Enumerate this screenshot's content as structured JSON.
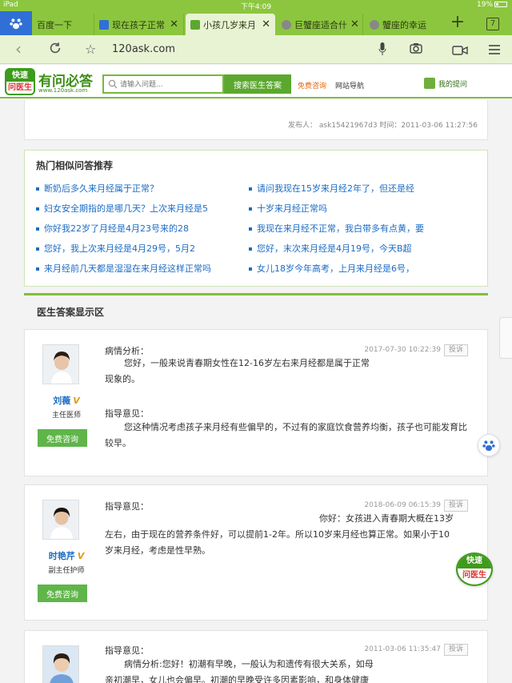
{
  "status_bar": {
    "device": "iPad",
    "time": "下午4:09",
    "battery": "19%"
  },
  "tabs": [
    {
      "label": "百度一下",
      "favicon_color": "#2f6fd6"
    },
    {
      "label": "现在孩子正常",
      "favicon_color": "#2f6fd6"
    },
    {
      "label": "小孩几岁来月",
      "favicon_color": "#5ba82e"
    },
    {
      "label": "巨蟹座适合什",
      "favicon_color": "#888888"
    },
    {
      "label": "蟹座的幸运",
      "favicon_color": "#888888"
    }
  ],
  "tab_count": "7",
  "address": {
    "url": "120ask.com"
  },
  "site": {
    "logo_top": "快速",
    "logo_bottom": "问医生",
    "name": "有问必答",
    "domain": "www.120ask.com",
    "search_placeholder": "请输入问题...",
    "search_button": "搜索医生答案",
    "free_consult": "免费咨询",
    "site_nav": "网站导航",
    "my_questions": "我的提问"
  },
  "question_meta": {
    "author_line": "发布人： ask15421967d3 时间：2011-03-06 11:27:56"
  },
  "hot": {
    "title": "热门相似问答推荐",
    "left": [
      "断奶后多久来月经属于正常？",
      "妇女安全期指的是哪几天？上次来月经是5",
      "你好我22岁了月经是4月23号来的28",
      "您好，我上次来月经是4月29号，5月2",
      "来月经前几天都是湿湿在来月经这样正常吗"
    ],
    "right": [
      "请问我现在15岁来月经2年了，但还是经",
      "十岁来月经正常吗",
      "我现在来月经不正常，我白带多有点黄，要",
      "您好，末次来月经是4月19号，今天B超",
      "女儿18岁今年高考，上月来月经是6号，"
    ]
  },
  "answers_section_title": "医生答案显示区",
  "answers": [
    {
      "doctor": "刘薇",
      "role": "主任医师",
      "consult": "免费咨询",
      "time": "2017-07-30 10:22:39",
      "report": "投诉",
      "label1": "病情分析：",
      "text1": "您好，一般来说青春期女性在12-16岁左右来月经都是属于正常现象的。",
      "label2": "指导意见：",
      "text2": "您这种情况考虑孩子来月经有些偏早的，不过有的家庭饮食营养均衡，孩子也可能发育比较早。"
    },
    {
      "doctor": "时艳芹",
      "role": "副主任护师",
      "consult": "免费咨询",
      "time": "2018-06-09 06:15:39",
      "report": "投诉",
      "label1": "指导意见：",
      "text1": "你好：女孩进入青春期大概在13岁左右，由于现在的营养条件好，可以提前1-2年。所以10岁来月经也算正常。如果小于10岁来月经，考虑是性早熟。"
    },
    {
      "time": "2011-03-06 11:35:47",
      "report": "投诉",
      "label1": "指导意见：",
      "text1": "病情分析:您好！初潮有早晚，一般认为和遗传有很大关系，如母亲初潮早，女儿也会偏早。初潮的早晚受许多因素影响，和身体健康状况"
    }
  ],
  "float_ask": {
    "top": "快速",
    "bottom": "问医生"
  },
  "v_badge": "V",
  "colors": {
    "brand_green": "#8cc63f",
    "link_blue": "#1b6cc4",
    "accent_orange": "#e2660e"
  }
}
